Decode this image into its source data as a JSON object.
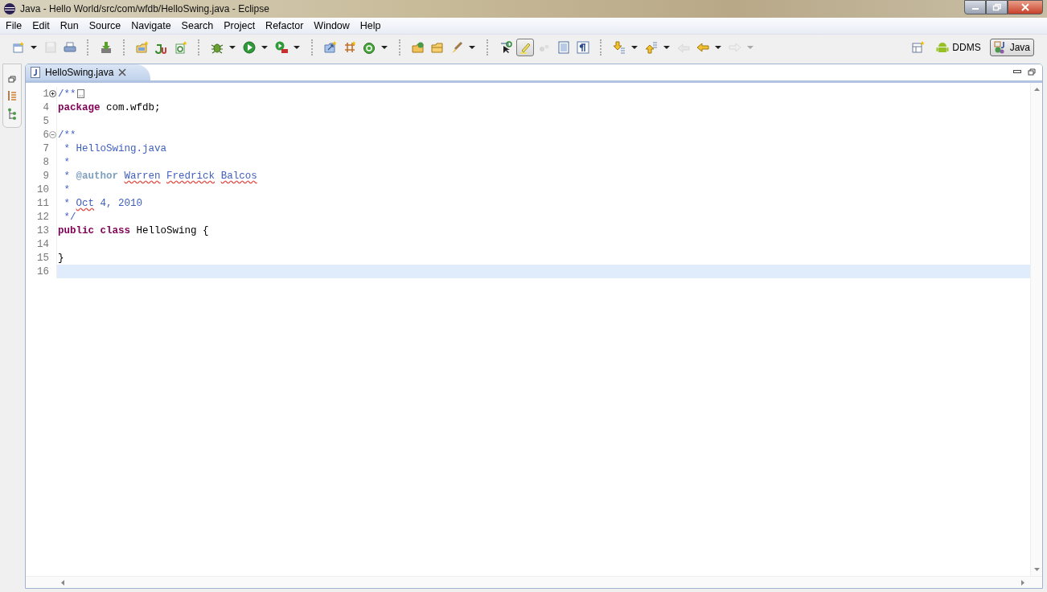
{
  "window": {
    "title": "Java - Hello World/src/com/wfdb/HelloSwing.java - Eclipse"
  },
  "menu": [
    "File",
    "Edit",
    "Run",
    "Source",
    "Navigate",
    "Search",
    "Project",
    "Refactor",
    "Window",
    "Help"
  ],
  "toolbar": [
    {
      "kind": "new",
      "dropdown": true,
      "disabled": false,
      "pressed": false
    },
    {
      "kind": "save",
      "dropdown": false,
      "disabled": true,
      "pressed": false
    },
    {
      "kind": "print",
      "dropdown": false,
      "disabled": false,
      "pressed": false
    },
    {
      "kind": "sep"
    },
    {
      "kind": "download",
      "dropdown": false,
      "disabled": false,
      "pressed": false
    },
    {
      "kind": "sep"
    },
    {
      "kind": "newpkg",
      "dropdown": false,
      "disabled": false,
      "pressed": false
    },
    {
      "kind": "junit",
      "dropdown": false,
      "disabled": false,
      "pressed": false
    },
    {
      "kind": "newclass",
      "dropdown": false,
      "disabled": false,
      "pressed": false
    },
    {
      "kind": "sep"
    },
    {
      "kind": "bug",
      "dropdown": true,
      "disabled": false,
      "pressed": false
    },
    {
      "kind": "run",
      "dropdown": true,
      "disabled": false,
      "pressed": false
    },
    {
      "kind": "exttools",
      "dropdown": true,
      "disabled": false,
      "pressed": false
    },
    {
      "kind": "sep"
    },
    {
      "kind": "openpkg",
      "dropdown": false,
      "disabled": false,
      "pressed": false
    },
    {
      "kind": "grid",
      "dropdown": false,
      "disabled": false,
      "pressed": false
    },
    {
      "kind": "circle",
      "dropdown": true,
      "disabled": false,
      "pressed": false
    },
    {
      "kind": "sep"
    },
    {
      "kind": "openfolder",
      "dropdown": false,
      "disabled": false,
      "pressed": false
    },
    {
      "kind": "folder",
      "dropdown": false,
      "disabled": false,
      "pressed": false
    },
    {
      "kind": "brush",
      "dropdown": true,
      "disabled": false,
      "pressed": false
    },
    {
      "kind": "sep"
    },
    {
      "kind": "cursor",
      "dropdown": false,
      "disabled": false,
      "pressed": false
    },
    {
      "kind": "highlight",
      "dropdown": false,
      "disabled": false,
      "pressed": true
    },
    {
      "kind": "dots",
      "dropdown": false,
      "disabled": true,
      "pressed": false
    },
    {
      "kind": "panel",
      "dropdown": false,
      "disabled": false,
      "pressed": false
    },
    {
      "kind": "pilcrow",
      "dropdown": false,
      "disabled": false,
      "pressed": false
    },
    {
      "kind": "sep"
    },
    {
      "kind": "down",
      "dropdown": true,
      "disabled": false,
      "pressed": false
    },
    {
      "kind": "up",
      "dropdown": true,
      "disabled": false,
      "pressed": false
    },
    {
      "kind": "lastedit",
      "dropdown": false,
      "disabled": true,
      "pressed": false
    },
    {
      "kind": "back",
      "dropdown": true,
      "disabled": false,
      "pressed": false
    },
    {
      "kind": "forward",
      "dropdown": true,
      "disabled": true,
      "pressed": false
    }
  ],
  "perspectives": [
    {
      "label": "DDMS",
      "kind": "android",
      "selected": false
    },
    {
      "label": "Java",
      "kind": "java",
      "selected": true
    }
  ],
  "editor_tab": {
    "label": "HelloSwing.java"
  },
  "lines": [
    {
      "number": "1",
      "kind": "folded",
      "current": false,
      "tokens": [
        {
          "text": "/**",
          "kind": "doc"
        }
      ]
    },
    {
      "number": "4",
      "kind": "plain",
      "current": false,
      "tokens": [
        {
          "text": "package",
          "kind": "keyword"
        },
        {
          "text": " com.wfdb;",
          "kind": "plain"
        }
      ]
    },
    {
      "number": "5",
      "kind": "plain",
      "current": false
    },
    {
      "number": "6",
      "kind": "fold-open",
      "current": false,
      "tokens": [
        {
          "text": "/**",
          "kind": "doc"
        }
      ]
    },
    {
      "number": "7",
      "kind": "plain",
      "current": false,
      "tokens": [
        {
          "text": " * HelloSwing.java",
          "kind": "doc"
        }
      ]
    },
    {
      "number": "8",
      "kind": "plain",
      "current": false,
      "tokens": [
        {
          "text": " *",
          "kind": "doc"
        }
      ]
    },
    {
      "number": "9",
      "kind": "plain",
      "current": false,
      "tokens": [
        {
          "text": " * ",
          "kind": "doc"
        },
        {
          "text": "@author",
          "kind": "doctag"
        },
        {
          "text": " Warren",
          "kind": "misspelled"
        },
        {
          "text": " Fredrick",
          "kind": "misspelled"
        },
        {
          "text": " Balcos",
          "kind": "misspelled"
        }
      ]
    },
    {
      "number": "10",
      "kind": "plain",
      "current": false,
      "tokens": [
        {
          "text": " *",
          "kind": "doc"
        }
      ]
    },
    {
      "number": "11",
      "kind": "plain",
      "current": false,
      "tokens": [
        {
          "text": " * ",
          "kind": "doc"
        },
        {
          "text": "Oct",
          "kind": "misspelled"
        },
        {
          "text": " 4, 2010",
          "kind": "doc"
        }
      ]
    },
    {
      "number": "12",
      "kind": "plain",
      "current": false,
      "tokens": [
        {
          "text": " */",
          "kind": "doc"
        }
      ]
    },
    {
      "number": "13",
      "kind": "plain",
      "current": false,
      "tokens": [
        {
          "text": "public",
          "kind": "keyword"
        },
        {
          "text": " class",
          "kind": "keyword"
        },
        {
          "text": " HelloSwing {",
          "kind": "plain"
        }
      ]
    },
    {
      "number": "14",
      "kind": "plain",
      "current": false
    },
    {
      "number": "15",
      "kind": "plain",
      "current": false,
      "tokens": [
        {
          "text": "}",
          "kind": "plain"
        }
      ]
    },
    {
      "number": "16",
      "kind": "plain",
      "current": true
    }
  ]
}
